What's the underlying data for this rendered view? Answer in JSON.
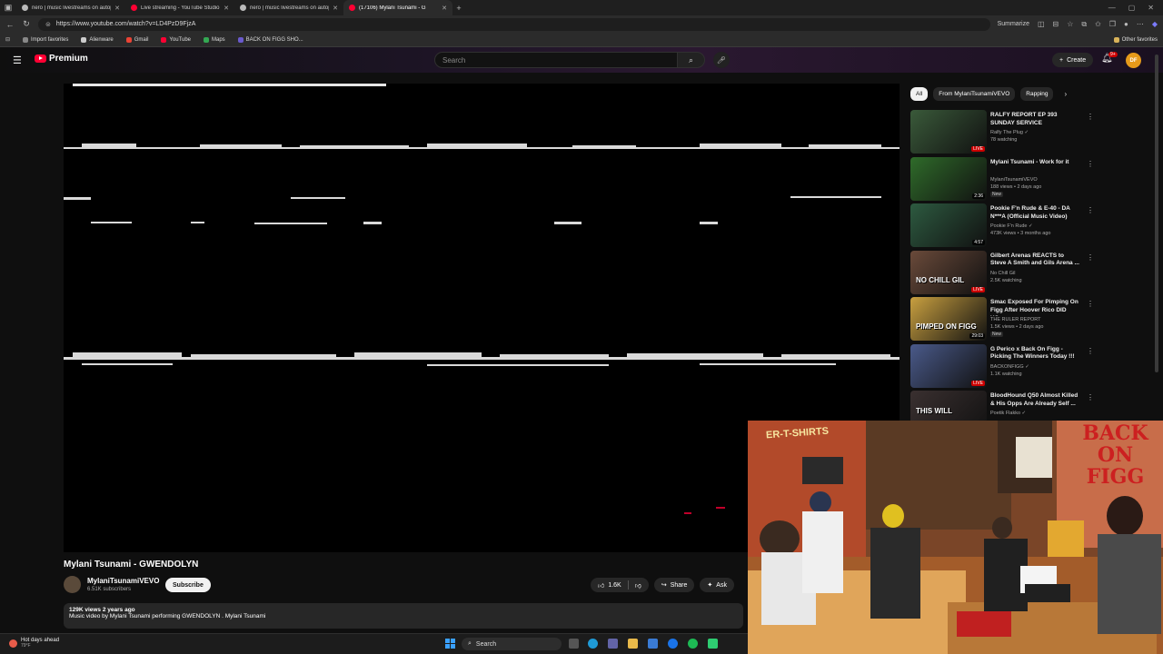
{
  "browser": {
    "tabs": [
      {
        "title": "nero | music livestreams on autop",
        "color": "#bbbbbb",
        "active": false
      },
      {
        "title": "Live streaming - YouTube Studio",
        "color": "#ff0033",
        "active": false
      },
      {
        "title": "nero | music livestreams on autop",
        "color": "#bbbbbb",
        "active": false
      },
      {
        "title": "(17106) Mylani Tsunami - G",
        "color": "#ff0033",
        "active": true
      }
    ],
    "url": "https://www.youtube.com/watch?v=LD4PzD9FjzA",
    "summarize": "Summarize",
    "bookmarks": [
      {
        "label": "Import favorites",
        "color": "#888888"
      },
      {
        "label": "Alienware",
        "color": "#cccccc"
      },
      {
        "label": "Gmail",
        "color": "#ea4335"
      },
      {
        "label": "YouTube",
        "color": "#ff0033"
      },
      {
        "label": "Maps",
        "color": "#34a853"
      },
      {
        "label": "BACK ON FIGG SHO...",
        "color": "#6a5acd"
      }
    ],
    "other_favorites": "Other favorites"
  },
  "yt": {
    "logo": "Premium",
    "search_placeholder": "Search",
    "create": "Create",
    "bell_badge": "9+",
    "avatar_initials": "DF"
  },
  "video": {
    "title": "Mylani Tsunami - GWENDOLYN",
    "channel": "MylaniTsunamiVEVO",
    "subscribers": "6.51K subscribers",
    "subscribe": "Subscribe",
    "likes": "1.6K",
    "share": "Share",
    "ask": "Ask",
    "stats": "129K views  2 years ago",
    "description": "Music video by Mylani Tsunami performing GWENDOLYN . Mylani Tsunami"
  },
  "sidebar": {
    "chips": [
      "All",
      "From MylaniTsunamiVEVO",
      "Rapping"
    ],
    "items": [
      {
        "title": "RALFY REPORT EP 393 SUNDAY SERVICE",
        "channel": "Ralfy The Plug ✓",
        "meta": "78 watching",
        "badge": "LIVE",
        "live": true,
        "new": "",
        "thumb": "#3a5a3a"
      },
      {
        "title": "Mylani Tsunami - Work for it",
        "channel": "MylaniTsunamiVEVO",
        "meta": "188 views • 2 days ago",
        "badge": "2:36",
        "live": false,
        "new": "New",
        "thumb": "#2f6b2a"
      },
      {
        "title": "Pookie F'n Rude & E-40 - DA N***A (Official Music Video)",
        "channel": "Pookie F'n Rude ✓",
        "meta": "473K views • 3 months ago",
        "badge": "4:57",
        "live": false,
        "new": "",
        "thumb": "#2d5a40"
      },
      {
        "title": "Gilbert Arenas REACTS to Steve A Smith and Gils Arena ...",
        "channel": "No Chill Gil",
        "meta": "2.5K watching",
        "badge": "LIVE",
        "live": true,
        "new": "",
        "thumb": "#6a4a3a"
      },
      {
        "title": "Smac Exposed For Pimping On Figg After Hoover Rico DID YO...",
        "channel": "THE RULER REPORT",
        "meta": "1.5K views • 2 days ago",
        "badge": "29:03",
        "live": false,
        "new": "New",
        "thumb": "#c9a040"
      },
      {
        "title": "G Perico x Back On Figg - Picking The Winners Today !!!",
        "channel": "BACKONFIGG ✓",
        "meta": "1.1K watching",
        "badge": "LIVE",
        "live": true,
        "new": "",
        "thumb": "#4a5a8a"
      },
      {
        "title": "BloodHound Q50 Almost Killed & His Opps Are Already Self ...",
        "channel": "Poetik Flakko ✓",
        "meta": "",
        "badge": "",
        "live": false,
        "new": "",
        "thumb": "#3a3030"
      }
    ],
    "thumb_texts": {
      "gil": "NO CHILL GIL",
      "smac": "PIMPED ON FIGG",
      "blood": "THIS WILL"
    }
  },
  "cam": {
    "sign_right": "BACK ON FIGG",
    "sign_left": "ER-T-SHIRTS"
  },
  "taskbar": {
    "weather_title": "Hot days ahead",
    "weather_sub": "79°F",
    "search": "Search"
  }
}
